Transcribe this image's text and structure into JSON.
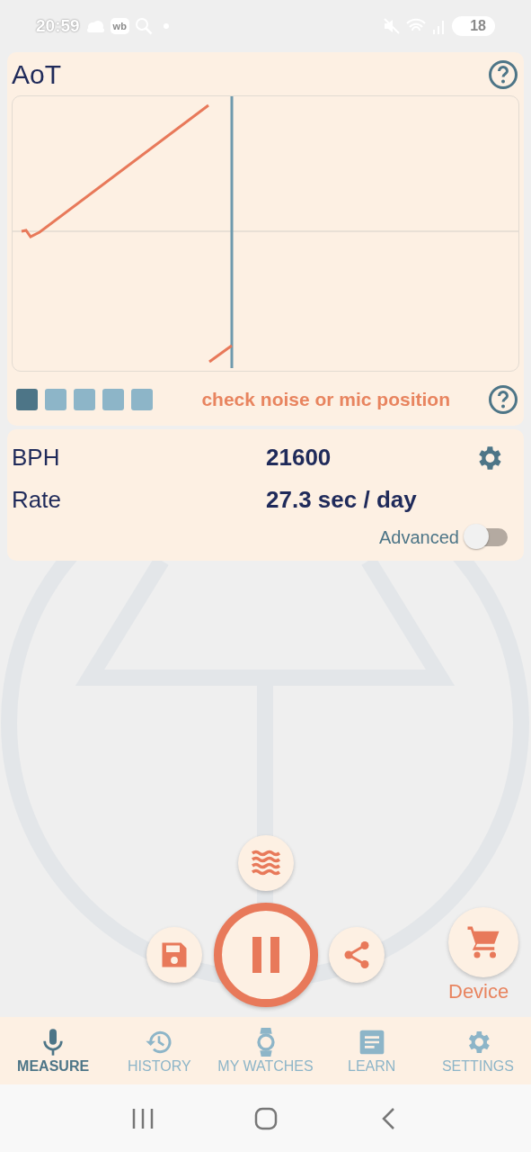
{
  "status_bar": {
    "time": "20:59",
    "app_badge": "wb",
    "battery": "18"
  },
  "aot_card": {
    "title": "AoT",
    "quality": [
      {
        "active": true
      },
      {
        "active": false
      },
      {
        "active": false
      },
      {
        "active": false
      },
      {
        "active": false
      }
    ],
    "warning": "check noise or mic position"
  },
  "stats_card": {
    "rows": [
      {
        "label": "BPH",
        "value": "21600"
      },
      {
        "label": "Rate",
        "value": "27.3 sec / day"
      }
    ],
    "advanced_toggle": {
      "label": "Advanced",
      "on": false
    }
  },
  "device_button": {
    "label": "Device"
  },
  "bottom_nav": [
    {
      "label": "MEASURE",
      "selected": true
    },
    {
      "label": "HISTORY",
      "selected": false
    },
    {
      "label": "MY WATCHES",
      "selected": false
    },
    {
      "label": "LEARN",
      "selected": false
    },
    {
      "label": "SETTINGS",
      "selected": false
    }
  ]
}
